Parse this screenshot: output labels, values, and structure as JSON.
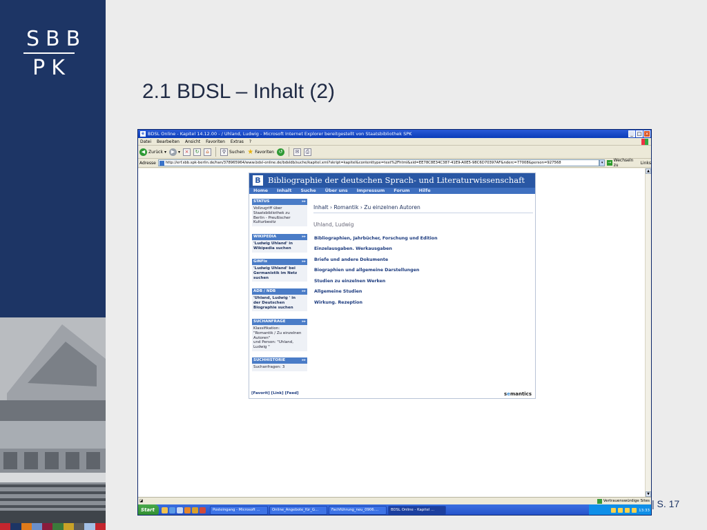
{
  "slide": {
    "logo_line1": "SBB",
    "logo_line2": "PK",
    "title": "2.1 BDSL – Inhalt (2)",
    "page_number": "| S. 17"
  },
  "browser": {
    "window_title": "BDSL Online - Kapitel 14.12.00 - / Uhland, Ludwig - Microsoft Internet Explorer bereitgestellt von Staatsbibliothek SPK",
    "menu": [
      "Datei",
      "Bearbeiten",
      "Ansicht",
      "Favoriten",
      "Extras",
      "?"
    ],
    "toolbar": {
      "back": "Zurück",
      "search": "Suchen",
      "favorites": "Favoriten"
    },
    "address_label": "Adresse",
    "address": "http://erf.sbb.spk-berlin.de/han/378965964/www.bdsl-online.de/bdsldb/suche/kapitel.xml?skript=kapitel&contenttype=text%2Fhtml&xid=EE78C8E34C387-41E9-A0E5-98C6D70397AF&nderc=77008&person=927568",
    "go": "Wechseln zu",
    "links": "Links",
    "status_zone": "Vertrauenswürdige Sites"
  },
  "taskbar": {
    "start": "Start",
    "tasks": [
      {
        "label": "Posteingang - Microsoft ..."
      },
      {
        "label": "Online_Angebote_für_G..."
      },
      {
        "label": "Fachführung_neu_0906...."
      },
      {
        "label": "BDSL Online - Kapitel ..."
      }
    ],
    "clock": "13:33"
  },
  "site": {
    "header": "Bibliographie der deutschen Sprach- und Literaturwissenschaft",
    "nav": [
      "Home",
      "Inhalt",
      "Suche",
      "Über uns",
      "Impressum",
      "Forum",
      "Hilfe"
    ],
    "sidebar": [
      {
        "head": "STATUS",
        "lines": [
          "Vollzugriff über",
          "Staatsbibliothek zu",
          "Berlin - Preußischer",
          "Kulturbesitz"
        ]
      },
      {
        "head": "WIKIPEDIA",
        "lines": [
          "'Ludwig Uhland' in",
          "Wikipedia suchen"
        ]
      },
      {
        "head": "GiNFix",
        "lines": [
          "'Ludwig Uhland' bei",
          "Germanistik im Netz",
          "suchen"
        ]
      },
      {
        "head": "ADB / NDB",
        "lines": [
          "'Uhland, Ludwig ' in",
          "der Deutschen",
          "Biographie suchen"
        ]
      },
      {
        "head": "SUCHANFRAGE",
        "lines": [
          "Klassifikation:",
          "\"Romantik / Zu einzelnen",
          "Autoren\"",
          "und Person: \"Uhland,",
          "Ludwig \""
        ]
      },
      {
        "head": "SUCHHISTORIE",
        "lines": [
          "Suchanfragen: 3"
        ]
      }
    ],
    "breadcrumb": "Inhalt › Romantik › Zu einzelnen Autoren",
    "person": "Uhland, Ludwig",
    "categories": [
      "Bibliographien, Jahrbücher, Forschung und Edition",
      "Einzelausgaben. Werkausgaben",
      "Briefe und andere Dokumente",
      "Biographien und allgemeine Darstellungen",
      "Studien zu einzelnen Werken",
      "Allgemeine Studien",
      "Wirkung. Rezeption"
    ],
    "footer": "[Favorit] [Link] [Feed]",
    "brand_a": "s",
    "brand_b": "e",
    "brand_c": "mantics"
  }
}
